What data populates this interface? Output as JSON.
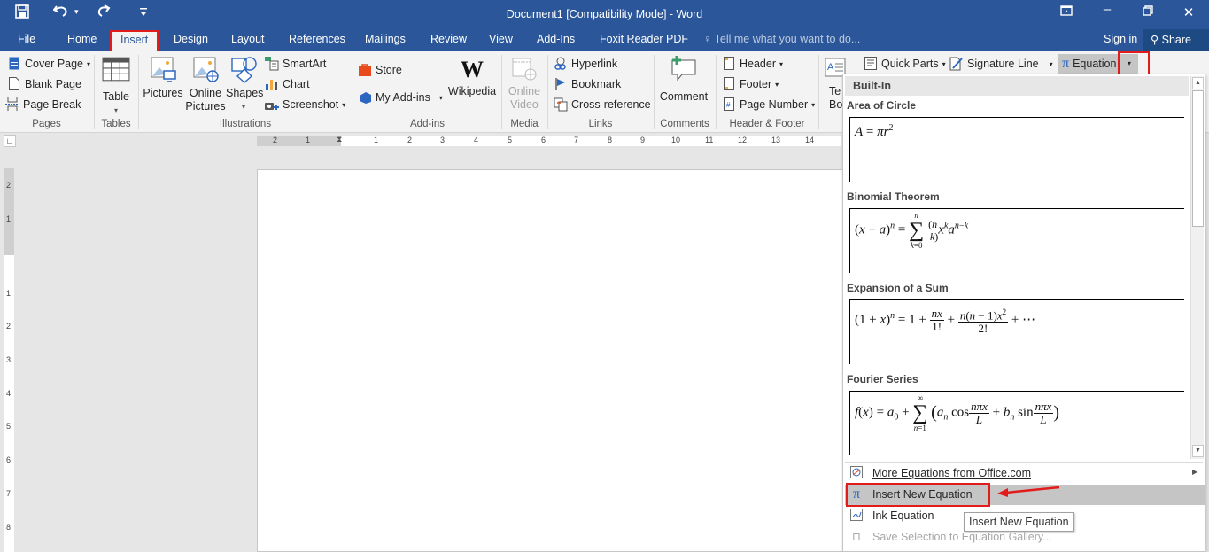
{
  "window": {
    "title": "Document1 [Compatibility Mode] - Word",
    "controls": {
      "ribbon_display": "ribbon-display-icon",
      "minimize": "minimize-icon",
      "restore": "restore-icon",
      "close": "close-icon"
    }
  },
  "quick_access": {
    "save": "save-icon",
    "undo": "undo-icon",
    "undo_dropdown": "▾",
    "redo": "redo-icon",
    "customize": "customize-icon"
  },
  "tabs": [
    {
      "label": "File"
    },
    {
      "label": "Home"
    },
    {
      "label": "Insert",
      "active": true
    },
    {
      "label": "Design"
    },
    {
      "label": "Layout"
    },
    {
      "label": "References"
    },
    {
      "label": "Mailings"
    },
    {
      "label": "Review"
    },
    {
      "label": "View"
    },
    {
      "label": "Add-Ins"
    },
    {
      "label": "Foxit Reader PDF"
    }
  ],
  "tell_me": "Tell me what you want to do...",
  "sign_in": "Sign in",
  "share": "Share",
  "ribbon": {
    "pages": {
      "label": "Pages",
      "cover_page": "Cover Page",
      "blank_page": "Blank Page",
      "page_break": "Page Break"
    },
    "tables": {
      "label": "Tables",
      "table": "Table"
    },
    "illustrations": {
      "label": "Illustrations",
      "pictures": "Pictures",
      "online_pictures_1": "Online",
      "online_pictures_2": "Pictures",
      "shapes": "Shapes",
      "smartart": "SmartArt",
      "chart": "Chart",
      "screenshot": "Screenshot"
    },
    "addins": {
      "label": "Add-ins",
      "store": "Store",
      "my_addins": "My Add-ins",
      "wikipedia": "Wikipedia"
    },
    "media": {
      "label": "Media",
      "online_video_1": "Online",
      "online_video_2": "Video"
    },
    "links": {
      "label": "Links",
      "hyperlink": "Hyperlink",
      "bookmark": "Bookmark",
      "cross_reference": "Cross-reference"
    },
    "comments": {
      "label": "Comments",
      "comment": "Comment"
    },
    "header_footer": {
      "label": "Header & Footer",
      "header": "Header",
      "footer": "Footer",
      "page_number": "Page Number"
    },
    "text": {
      "text_box_1": "Te",
      "text_box_2": "Bo",
      "quick_parts": "Quick Parts",
      "signature_line": "Signature Line",
      "equation": "Equation"
    }
  },
  "ruler": {
    "horizontal_left": [
      "2",
      "1"
    ],
    "horizontal_right": [
      "1",
      "2",
      "3",
      "4",
      "5",
      "6",
      "7",
      "8",
      "9",
      "10",
      "11",
      "12",
      "13",
      "14"
    ],
    "vertical_top": [
      "2",
      "1"
    ],
    "vertical": [
      "1",
      "2",
      "3",
      "4",
      "5",
      "6",
      "7",
      "8"
    ]
  },
  "equation_gallery": {
    "section": "Built-In",
    "items": [
      {
        "title": "Area of Circle",
        "formula": "A = πr²"
      },
      {
        "title": "Binomial Theorem",
        "formula": "(x + a)ⁿ = Σ_{k=0}^{n} (n choose k) xᵏ aⁿ⁻ᵏ"
      },
      {
        "title": "Expansion of a Sum",
        "formula": "(1 + x)ⁿ = 1 + nx/1! + n(n − 1)x²/2! + ⋯"
      },
      {
        "title": "Fourier Series",
        "formula": "f(x) = a₀ + Σ_{n=1}^{∞} (aₙ cos nπx/L + bₙ sin nπx/L)"
      }
    ],
    "menu": [
      {
        "label": "More Equations from Office.com",
        "icon": "office-equations-icon",
        "submenu": true
      },
      {
        "label": "Insert New Equation",
        "icon": "pi-icon",
        "highlighted": true
      },
      {
        "label": "Ink Equation",
        "icon": "ink-equation-icon"
      },
      {
        "label": "Save Selection to Equation Gallery...",
        "icon": "save-equation-icon",
        "disabled": true
      }
    ],
    "tooltip": "Insert New Equation"
  },
  "annotations": {
    "highlight_color": "#e21b1b"
  },
  "colors": {
    "title_bar": "#2b579a",
    "ribbon": "#f3f3f3",
    "accent_red": "#e21b1b"
  }
}
